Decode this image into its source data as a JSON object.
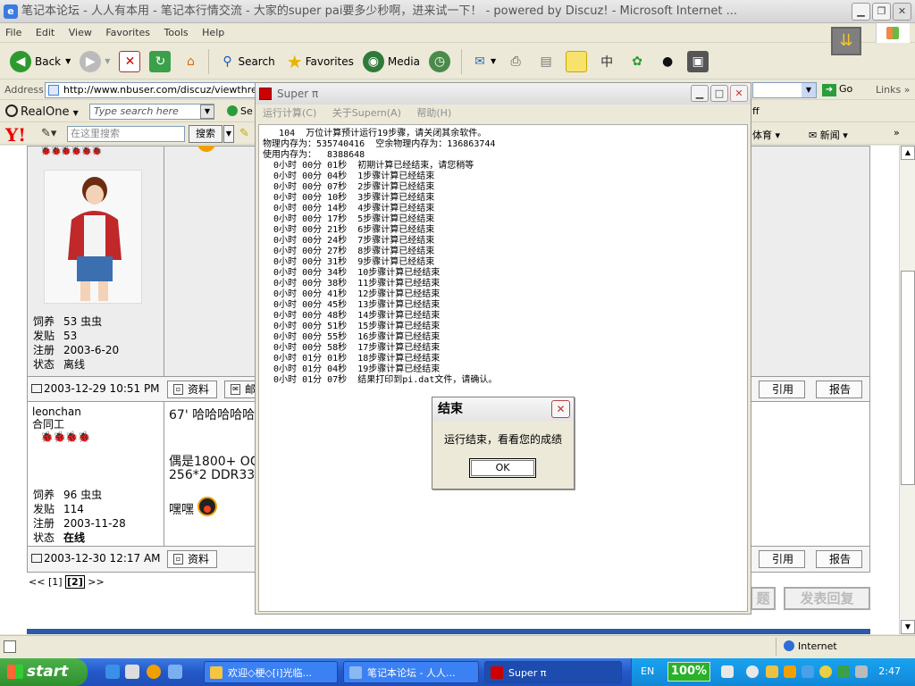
{
  "ie": {
    "title": "笔记本论坛 - 人人有本用 - 笔记本行情交流 - 大家的super pai要多少秒啊，进来试一下！ - powered by Discuz! - Microsoft Internet ...",
    "menu": [
      "File",
      "Edit",
      "View",
      "Favorites",
      "Tools",
      "Help"
    ],
    "toolbar": {
      "back": "Back",
      "search": "Search",
      "favorites": "Favorites",
      "media": "Media"
    },
    "address_label": "Address",
    "url": "http://www.nbuser.com/discuz/viewthread.p",
    "go": "Go",
    "links": "Links",
    "realone": "RealOne",
    "realone_search_placeholder": "Type search here",
    "realone_search_btn": "Se",
    "realone_right": "ff",
    "yahoo_logo": "Y!",
    "yahoo_search_placeholder": "在这里搜索",
    "yahoo_search_btn": "搜索",
    "yahoo_right1": "体育",
    "yahoo_right2": "新闻",
    "status_zone": "Internet"
  },
  "forum": {
    "post1": {
      "stats": [
        {
          "k": "饲养",
          "v": "53 虫虫"
        },
        {
          "k": "发贴",
          "v": "53"
        },
        {
          "k": "注册",
          "v": "2003-6-20"
        },
        {
          "k": "状态",
          "v": "离线"
        }
      ],
      "date": "2003-12-29 10:51 PM",
      "btn_profile": "资料",
      "btn_mail": "邮",
      "btn_quote": "引用",
      "btn_report": "报告"
    },
    "post2": {
      "username": "leonchan",
      "usertitle": "合同工",
      "stats": [
        {
          "k": "饲养",
          "v": "96 虫虫"
        },
        {
          "k": "发贴",
          "v": "114"
        },
        {
          "k": "注册",
          "v": "2003-11-28"
        },
        {
          "k": "状态",
          "v": "在线"
        }
      ],
      "line1": "67' 哈哈哈哈哈",
      "line2": "偶是1800+ OC",
      "line3": "256*2 DDR33",
      "line4": "嘿嘿",
      "date": "2003-12-30 12:17 AM",
      "btn_profile": "资料",
      "btn_quote": "引用",
      "btn_report": "报告"
    },
    "pager": {
      "prev": "<<",
      "page1": "[1]",
      "page2": "[2]",
      "next": ">>"
    },
    "btn_post_ghost": "发表回复",
    "btn_newtopic_ghost": "题"
  },
  "superpi": {
    "title": "Super π",
    "menu": [
      "运行计算(C)",
      "关于Supern(A)",
      "帮助(H)"
    ],
    "header_line": "   104  万位计算预计运行19步骤，请关闭其余软件。",
    "mem_line": "物理内存为：535740416  空余物理内存为：136863744",
    "used_line": "使用内存为：  8388648",
    "lines": [
      "  0小时 00分 01秒  初期计算已经结束，请您稍等",
      "  0小时 00分 04秒  1步骤计算已经结束",
      "  0小时 00分 07秒  2步骤计算已经结束",
      "  0小时 00分 10秒  3步骤计算已经结束",
      "  0小时 00分 14秒  4步骤计算已经结束",
      "  0小时 00分 17秒  5步骤计算已经结束",
      "  0小时 00分 21秒  6步骤计算已经结束",
      "  0小时 00分 24秒  7步骤计算已经结束",
      "  0小时 00分 27秒  8步骤计算已经结束",
      "  0小时 00分 31秒  9步骤计算已经结束",
      "  0小时 00分 34秒  10步骤计算已经结束",
      "  0小时 00分 38秒  11步骤计算已经结束",
      "  0小时 00分 41秒  12步骤计算已经结束",
      "  0小时 00分 45秒  13步骤计算已经结束",
      "  0小时 00分 48秒  14步骤计算已经结束",
      "  0小时 00分 51秒  15步骤计算已经结束",
      "  0小时 00分 55秒  16步骤计算已经结束",
      "  0小时 00分 58秒  17步骤计算已经结束",
      "  0小时 01分 01秒  18步骤计算已经结束",
      "  0小时 01分 04秒  19步骤计算已经结束",
      "  0小时 01分 07秒  结果打印到pi.dat文件，请确认。"
    ]
  },
  "dialog": {
    "title": "结束",
    "message": "运行结束，看看您的成绩",
    "ok": "OK"
  },
  "taskbar": {
    "start": "start",
    "tasks": [
      "欢迎◇梗◇[i]光临...",
      "笔记本论坛 - 人人...",
      "Super π"
    ],
    "lang": "EN",
    "battery": "100%",
    "clock": "2:47"
  },
  "colors": {
    "taskbar": "#2458c8",
    "start": "#2f8f2e",
    "tray": "#1288d8",
    "forum_blue": "#2b5aa8"
  }
}
